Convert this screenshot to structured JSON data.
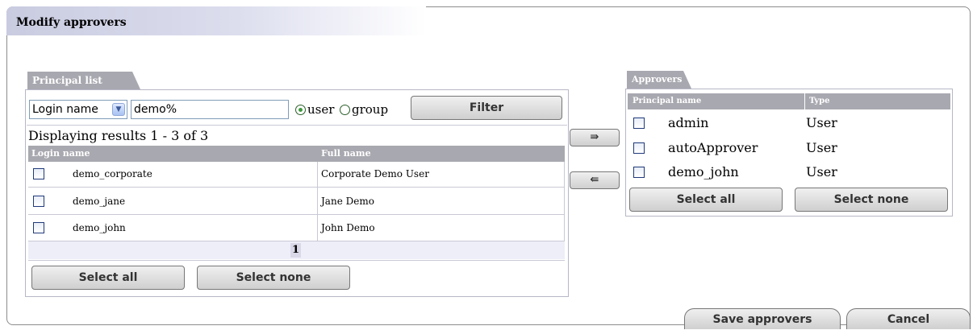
{
  "window": {
    "title": "Modify approvers"
  },
  "principal_list": {
    "tab_label": "Principal list",
    "search_field_selected": "Login name",
    "search_value": "demo%",
    "radio_user_label": "user",
    "radio_group_label": "group",
    "filter_label": "Filter",
    "results_text": "Displaying results 1 - 3 of 3",
    "columns": [
      "Login name",
      "Full name"
    ],
    "rows": [
      {
        "login": "demo_corporate",
        "fullname": "Corporate Demo User"
      },
      {
        "login": "demo_jane",
        "fullname": "Jane Demo"
      },
      {
        "login": "demo_john",
        "fullname": "John Demo"
      }
    ],
    "page_number": "1",
    "select_all_label": "Select all",
    "select_none_label": "Select none"
  },
  "transfer": {
    "add_icon": "arrow-right-icon",
    "remove_icon": "arrow-left-icon",
    "add_glyph": "⇛",
    "remove_glyph": "⇚"
  },
  "approvers": {
    "tab_label": "Approvers",
    "columns": [
      "Principal name",
      "Type"
    ],
    "rows": [
      {
        "name": "admin",
        "type": "User"
      },
      {
        "name": "autoApprover",
        "type": "User"
      },
      {
        "name": "demo_john",
        "type": "User"
      }
    ],
    "select_all_label": "Select all",
    "select_none_label": "Select none"
  },
  "footer": {
    "save_label": "Save approvers",
    "cancel_label": "Cancel"
  }
}
